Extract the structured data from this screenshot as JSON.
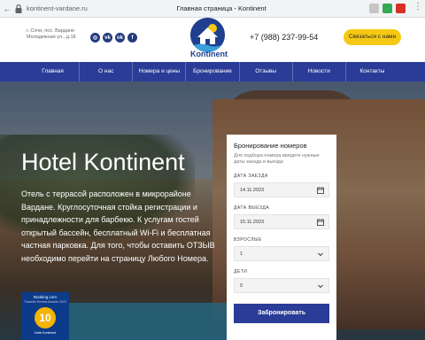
{
  "browser": {
    "url": "kontinent-vardane.ru",
    "tab_title": "Главная страница - Kontinent",
    "back_glyph": "←"
  },
  "header": {
    "address": "г. Сочи, пос. Вардане Молодежная ул., д.18",
    "socials": [
      {
        "icon": "instagram-icon",
        "glyph": "◎"
      },
      {
        "icon": "vk-icon",
        "glyph": "vk"
      },
      {
        "icon": "ok-icon",
        "glyph": "ok"
      },
      {
        "icon": "facebook-icon",
        "glyph": "f"
      }
    ],
    "logo_text": "Kontinent",
    "phone": "+7 (988) 237-99-54",
    "contact_button": "Связаться с нами"
  },
  "nav": {
    "items": [
      "Главная",
      "О нас",
      "Номера и цены",
      "Бронирование",
      "Отзывы",
      "Новости",
      "Контакты"
    ]
  },
  "hero": {
    "title": "Hotel Kontinent",
    "description": "Отель с террасой расположен в микрорайоне Вардане. Круглосуточная стойка регистрации и принадлежности для барбекю. К услугам гостей открытый бассейн, бесплатный Wi-Fi и бесплатная частная парковка. Для того, чтобы оставить ОТЗЫВ необходимо перейти на страницу Любого Номера.",
    "badge": {
      "brand": "Booking.com",
      "subtitle": "Traveller Review Awards 2023",
      "score": "10",
      "bottom": "Hotel Kontinent"
    }
  },
  "booking": {
    "title": "Бронирование номеров",
    "subtitle": "Для подбора номера введите нужные даты заезда и выезда",
    "checkin_label": "ДАТА ЗАЕЗДА",
    "checkin_value": "14.11.2023",
    "checkout_label": "ДАТА ВЫЕЗДА",
    "checkout_value": "15.11.2023",
    "adults_label": "ВЗРОСЛЫЕ",
    "adults_value": "1",
    "children_label": "ДЕТИ",
    "children_value": "0",
    "submit": "Забронировать"
  },
  "colors": {
    "nav_bg": "#2a3c97",
    "button_yellow": "#f5c913",
    "logo_blue": "#1f3f8f"
  }
}
